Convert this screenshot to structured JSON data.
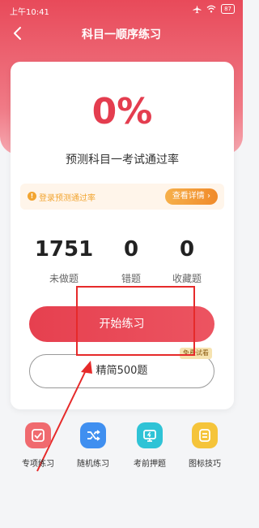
{
  "status_bar": {
    "time": "上午10:41",
    "battery": "87"
  },
  "header": {
    "title": "科目一顺序练习"
  },
  "score": {
    "percent": "0%",
    "label": "预测科目一考试通过率"
  },
  "notice": {
    "text": "登录预测通过率",
    "button_label": "查看详情"
  },
  "stats": [
    {
      "value": "1751",
      "label": "未做题"
    },
    {
      "value": "0",
      "label": "错题"
    },
    {
      "value": "0",
      "label": "收藏题"
    }
  ],
  "actions": {
    "start_label": "开始练习",
    "simple_label": "精简500题",
    "free_badge": "免费试看"
  },
  "tools": [
    {
      "label": "专项练习",
      "icon": "checkbox-icon",
      "color": "#f06a6f"
    },
    {
      "label": "随机练习",
      "icon": "shuffle-icon",
      "color": "#3f8ff0"
    },
    {
      "label": "考前押题",
      "icon": "monitor-icon",
      "color": "#2fc3d6"
    },
    {
      "label": "图标技巧",
      "icon": "card-icon",
      "color": "#f5c43a"
    }
  ],
  "colors": {
    "brand": "#e84a5a",
    "accent_orange": "#f2a531",
    "annotation_red": "#e62a2a"
  }
}
